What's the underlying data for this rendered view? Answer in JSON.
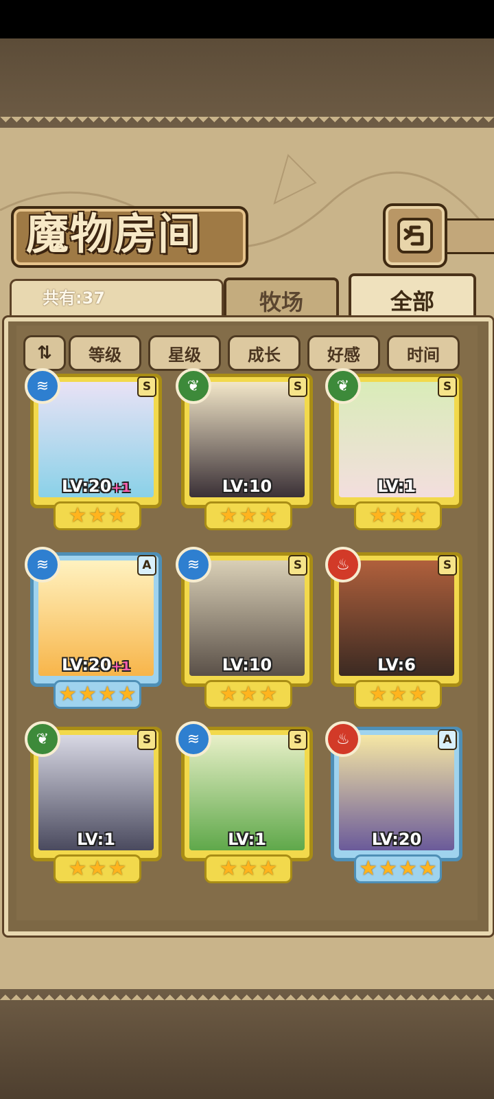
{
  "title": "魔物房间",
  "count_label": "共有:37",
  "tabs": [
    {
      "label": "牧场",
      "active": false
    },
    {
      "label": "全部",
      "active": true
    }
  ],
  "sort_toggle_label": "⇅",
  "sort_buttons": [
    "等级",
    "星级",
    "成长",
    "好感",
    "时间"
  ],
  "cards": [
    {
      "element": "water-icon",
      "rank": "S",
      "level": "LV:20",
      "bonus": "+1",
      "stars": 3,
      "frame": "gold"
    },
    {
      "element": "leaf-icon",
      "rank": "S",
      "level": "LV:10",
      "bonus": "",
      "stars": 3,
      "frame": "gold"
    },
    {
      "element": "leaf-icon",
      "rank": "S",
      "level": "LV:1",
      "bonus": "",
      "stars": 3,
      "frame": "gold"
    },
    {
      "element": "water-icon",
      "rank": "A",
      "level": "LV:20",
      "bonus": "+1",
      "stars": 4,
      "frame": "blue"
    },
    {
      "element": "water-icon",
      "rank": "S",
      "level": "LV:10",
      "bonus": "",
      "stars": 3,
      "frame": "gold"
    },
    {
      "element": "fire-icon",
      "rank": "S",
      "level": "LV:6",
      "bonus": "",
      "stars": 3,
      "frame": "gold"
    },
    {
      "element": "leaf-icon",
      "rank": "S",
      "level": "LV:1",
      "bonus": "",
      "stars": 3,
      "frame": "gold"
    },
    {
      "element": "water-icon",
      "rank": "S",
      "level": "LV:1",
      "bonus": "",
      "stars": 3,
      "frame": "gold"
    },
    {
      "element": "fire-icon",
      "rank": "A",
      "level": "LV:20",
      "bonus": "",
      "stars": 4,
      "frame": "blue"
    }
  ],
  "colors": {
    "gold_frame": "#f2d94c",
    "blue_frame": "#9fd3ee",
    "star": "#ffb41e",
    "bonus": "#ff5fb1"
  }
}
